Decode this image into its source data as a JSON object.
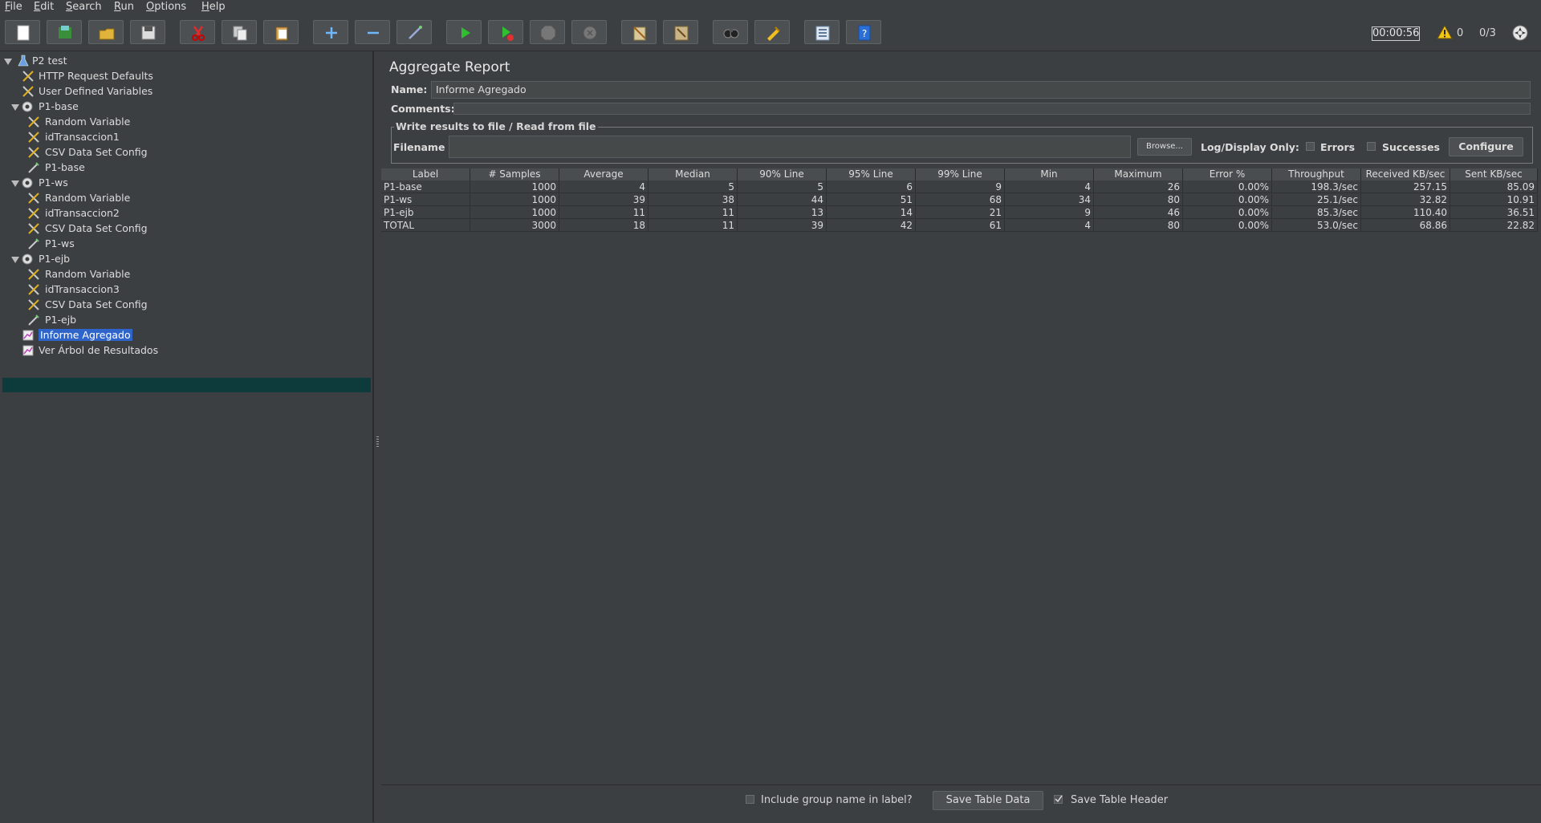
{
  "menu": [
    {
      "mn": "F",
      "rest": "ile"
    },
    {
      "mn": "E",
      "rest": "dit"
    },
    {
      "mn": "S",
      "rest": "earch"
    },
    {
      "mn": "R",
      "rest": "un"
    },
    {
      "mn": "O",
      "rest": "ptions"
    },
    {
      "mn": "H",
      "rest": "elp"
    }
  ],
  "toolbar": {
    "icons": [
      "new-icon",
      "templates-icon",
      "open-icon",
      "save-icon",
      "cut-icon",
      "copy-icon",
      "paste-icon",
      "expand-icon",
      "collapse-icon",
      "toggle-icon",
      "start-icon",
      "start-no-pauses-icon",
      "stop-icon",
      "shutdown-icon",
      "clear-icon",
      "clear-all-icon",
      "search-icon",
      "reset-search-icon",
      "function-helper-icon",
      "help-icon"
    ],
    "timer": "00:00:56",
    "warnings": "0",
    "threads": "0/3"
  },
  "tree": [
    {
      "label": "P2 test",
      "icon": "test-plan-icon",
      "depth": 0,
      "toggle": true
    },
    {
      "label": "HTTP Request Defaults",
      "icon": "config-icon",
      "depth": 1
    },
    {
      "label": "User Defined Variables",
      "icon": "config-icon",
      "depth": 1
    },
    {
      "label": "P1-base",
      "icon": "thread-group-icon",
      "depth": 1,
      "toggle": true
    },
    {
      "label": "Random Variable",
      "icon": "config-icon",
      "depth": 2
    },
    {
      "label": "idTransaccion1",
      "icon": "config-icon",
      "depth": 2
    },
    {
      "label": "CSV Data Set Config",
      "icon": "config-icon",
      "depth": 2
    },
    {
      "label": "P1-base",
      "icon": "sampler-icon",
      "depth": 2
    },
    {
      "label": "P1-ws",
      "icon": "thread-group-icon",
      "depth": 1,
      "toggle": true
    },
    {
      "label": "Random Variable",
      "icon": "config-icon",
      "depth": 2
    },
    {
      "label": "idTransaccion2",
      "icon": "config-icon",
      "depth": 2
    },
    {
      "label": "CSV Data Set Config",
      "icon": "config-icon",
      "depth": 2
    },
    {
      "label": "P1-ws",
      "icon": "sampler-icon",
      "depth": 2
    },
    {
      "label": "P1-ejb",
      "icon": "thread-group-icon",
      "depth": 1,
      "toggle": true
    },
    {
      "label": "Random Variable",
      "icon": "config-icon",
      "depth": 2
    },
    {
      "label": "idTransaccion3",
      "icon": "config-icon",
      "depth": 2
    },
    {
      "label": "CSV Data Set Config",
      "icon": "config-icon",
      "depth": 2
    },
    {
      "label": "P1-ejb",
      "icon": "sampler-icon",
      "depth": 2
    },
    {
      "label": "Informe Agregado",
      "icon": "listener-icon",
      "depth": 1,
      "selected": true
    },
    {
      "label": "Ver Árbol de Resultados",
      "icon": "listener-icon",
      "depth": 1
    }
  ],
  "report": {
    "title": "Aggregate Report",
    "name_label": "Name:",
    "name_value": "Informe Agregado",
    "comments_label": "Comments:",
    "comments_value": "",
    "group_title": "Write results to file / Read from file",
    "filename_label": "Filename",
    "filename_value": "",
    "browse": "Browse...",
    "log_display": "Log/Display Only:",
    "errors": "Errors",
    "successes": "Successes",
    "configure": "Configure"
  },
  "table": {
    "headers": [
      "Label",
      "# Samples",
      "Average",
      "Median",
      "90% Line",
      "95% Line",
      "99% Line",
      "Min",
      "Maximum",
      "Error %",
      "Throughput",
      "Received KB/sec",
      "Sent KB/sec"
    ],
    "rows": [
      [
        "P1-base",
        "1000",
        "4",
        "5",
        "5",
        "6",
        "9",
        "4",
        "26",
        "0.00%",
        "198.3/sec",
        "257.15",
        "85.09"
      ],
      [
        "P1-ws",
        "1000",
        "39",
        "38",
        "44",
        "51",
        "68",
        "34",
        "80",
        "0.00%",
        "25.1/sec",
        "32.82",
        "10.91"
      ],
      [
        "P1-ejb",
        "1000",
        "11",
        "11",
        "13",
        "14",
        "21",
        "9",
        "46",
        "0.00%",
        "85.3/sec",
        "110.40",
        "36.51"
      ],
      [
        "TOTAL",
        "3000",
        "18",
        "11",
        "39",
        "42",
        "61",
        "4",
        "80",
        "0.00%",
        "53.0/sec",
        "68.86",
        "22.82"
      ]
    ]
  },
  "bottom": {
    "include_group": "Include group name in label?",
    "include_group_checked": false,
    "save_table_data": "Save Table Data",
    "save_table_header": "Save Table Header",
    "save_table_header_checked": true
  }
}
